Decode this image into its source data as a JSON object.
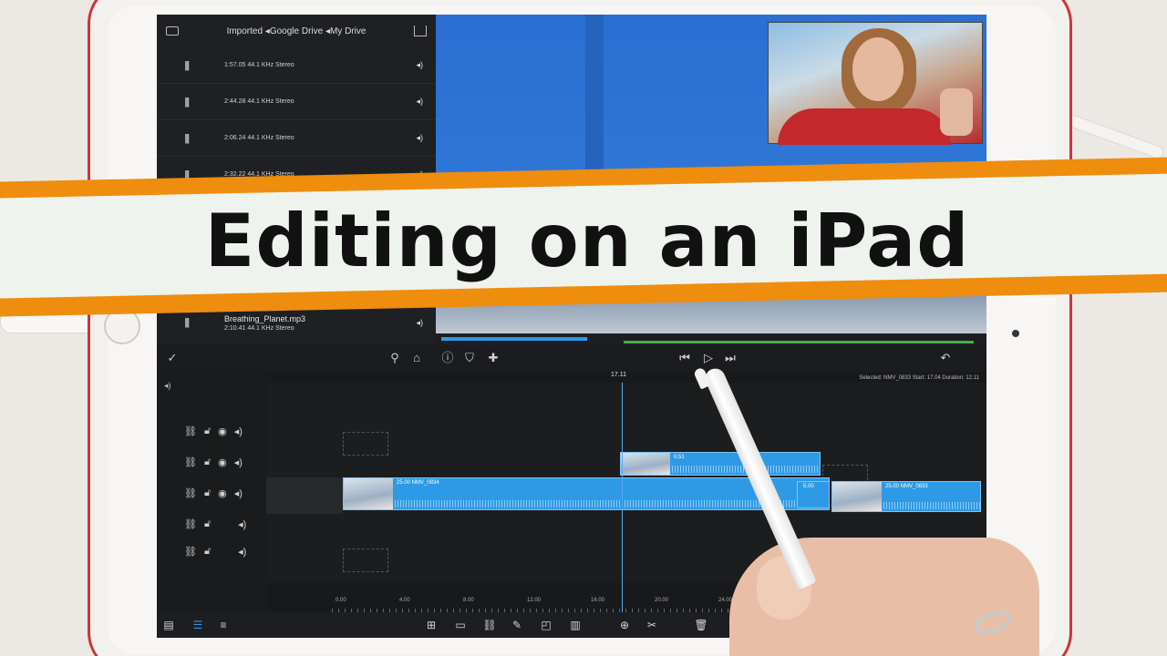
{
  "banner": {
    "title": "Editing on an iPad"
  },
  "media_browser": {
    "breadcrumb": "Imported ◂Google Drive ◂My Drive",
    "items": [
      {
        "name": "",
        "duration": "1:57.05",
        "meta": "44.1 KHz Stereo"
      },
      {
        "name": "",
        "duration": "2:44.28",
        "meta": "44.1 KHz Stereo"
      },
      {
        "name": "",
        "duration": "2:06.24",
        "meta": "44.1 KHz Stereo"
      },
      {
        "name": "",
        "duration": "2:32.22",
        "meta": "44.1 KHz Stereo"
      },
      {
        "name": "Breathing_Planet.mp3",
        "duration": "2:10.41",
        "meta": "44.1 KHz Stereo"
      }
    ]
  },
  "timeline": {
    "playhead_time": "17.11",
    "selected_info": "Selected: NMV_0833 Start: 17.04 Duration: 12.11",
    "ruler": [
      "0.00",
      "4.00",
      "8.00",
      "12.00",
      "16.00",
      "20.00",
      "24.00"
    ],
    "clips": {
      "overlay_clip": "0.51",
      "main_clip": "25.00 NMV_0834",
      "clip_b": "5.00",
      "clip_c": "25.00 NMV_0833"
    }
  },
  "colors": {
    "banner_stripe": "#ef8d0e",
    "banner_paper": "#eef3ed",
    "clip_blue": "#2e9ae5",
    "progress_green": "#3db348",
    "device_red": "#c9363a"
  },
  "icons": {
    "toolbar": [
      "check-circle-icon",
      "search-icon",
      "camera-plus-icon",
      "info-icon",
      "shield-icon",
      "add-anchor-icon",
      "skip-back-icon",
      "play-icon",
      "skip-forward-icon",
      "undo-icon"
    ],
    "track": [
      "link-icon",
      "lock-icon",
      "eye-icon",
      "speaker-icon"
    ],
    "bottom": [
      "add-media-icon",
      "clip-icon",
      "link-icon",
      "pen-icon",
      "snapshot-icon",
      "library-icon",
      "add-icon",
      "scissors-icon",
      "trash-icon"
    ]
  }
}
